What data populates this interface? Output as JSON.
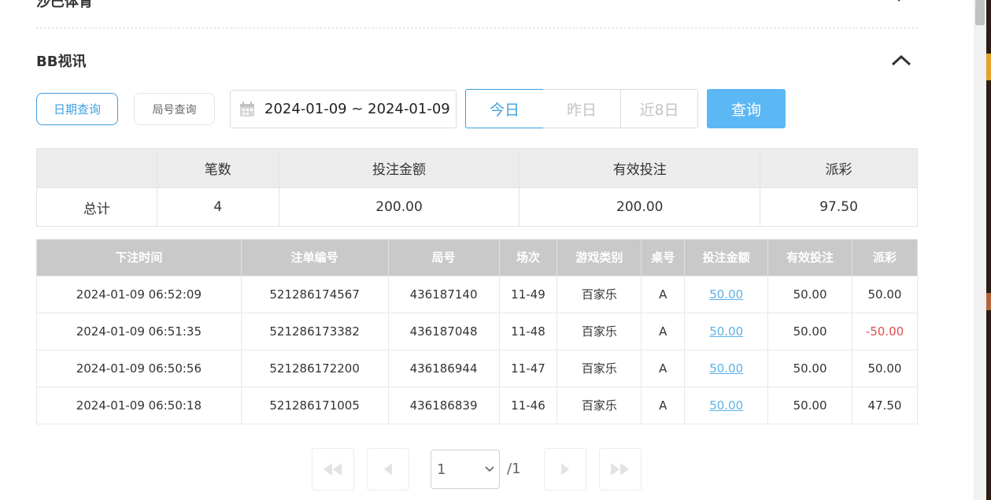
{
  "prev_section": {
    "title": "沙巴体育"
  },
  "section": {
    "title": "BB视讯"
  },
  "filters": {
    "date_query_label": "日期查询",
    "round_query_label": "局号查询",
    "date_range": "2024-01-09 ~ 2024-01-09",
    "quick_ranges": [
      "今日",
      "昨日",
      "近8日"
    ],
    "active_quick_range": "今日",
    "query_label": "查询"
  },
  "summary": {
    "headers": [
      "",
      "笔数",
      "投注金额",
      "有效投注",
      "派彩"
    ],
    "row": [
      "总计",
      "4",
      "200.00",
      "200.00",
      "97.50"
    ]
  },
  "records": {
    "headers": [
      "下注时间",
      "注单编号",
      "局号",
      "场次",
      "游戏类别",
      "桌号",
      "投注金额",
      "有效投注",
      "派彩"
    ],
    "rows": [
      [
        "2024-01-09 06:52:09",
        "521286174567",
        "436187140",
        "11-49",
        "百家乐",
        "A",
        "50.00",
        "50.00",
        "50.00"
      ],
      [
        "2024-01-09 06:51:35",
        "521286173382",
        "436187048",
        "11-48",
        "百家乐",
        "A",
        "50.00",
        "50.00",
        "-50.00"
      ],
      [
        "2024-01-09 06:50:56",
        "521286172200",
        "436186944",
        "11-47",
        "百家乐",
        "A",
        "50.00",
        "50.00",
        "50.00"
      ],
      [
        "2024-01-09 06:50:18",
        "521286171005",
        "436186839",
        "11-46",
        "百家乐",
        "A",
        "50.00",
        "50.00",
        "47.50"
      ]
    ]
  },
  "pagination": {
    "current_page": "1",
    "total": "/1"
  },
  "colors": {
    "accent": "#3d9fe0",
    "query_bg": "#5bb8f5",
    "negative": "#e04b4b",
    "link": "#5bb2e8"
  }
}
